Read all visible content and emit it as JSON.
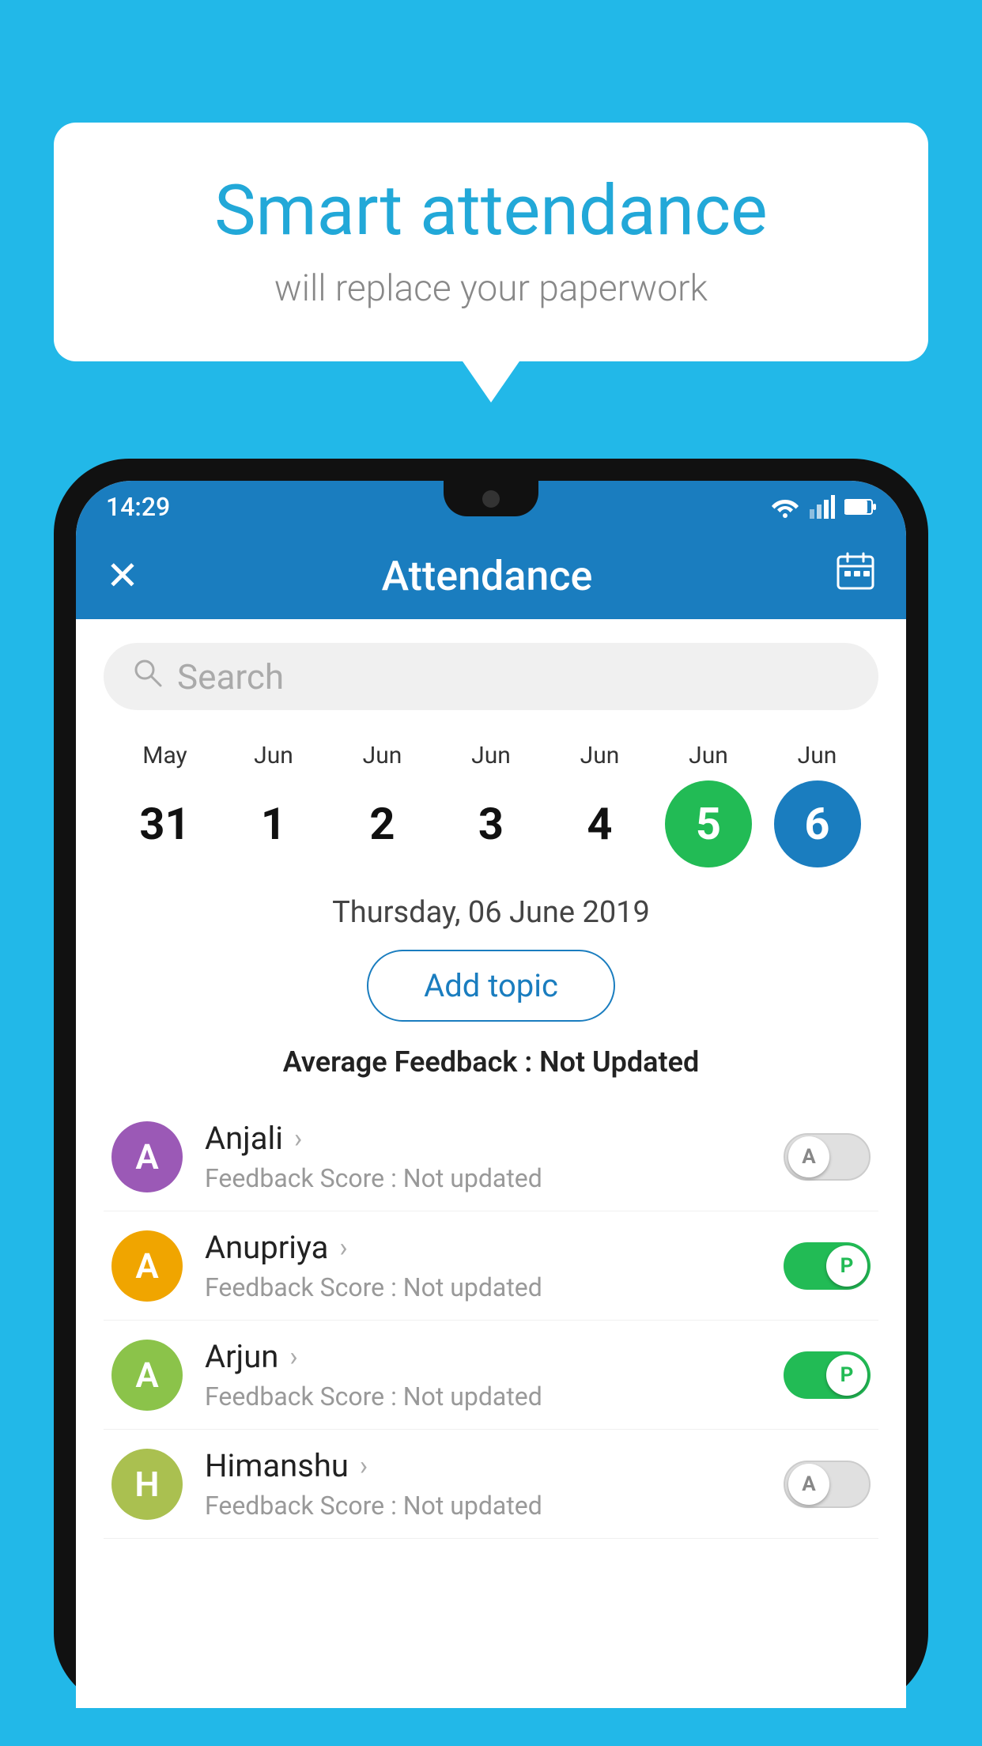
{
  "background_color": "#22b8e8",
  "speech_bubble": {
    "title": "Smart attendance",
    "subtitle": "will replace your paperwork"
  },
  "status_bar": {
    "time": "14:29"
  },
  "app_bar": {
    "title": "Attendance",
    "close_icon": "✕",
    "calendar_icon": "📅"
  },
  "search": {
    "placeholder": "Search"
  },
  "calendar": {
    "days": [
      {
        "month": "May",
        "date": "31",
        "style": "normal"
      },
      {
        "month": "Jun",
        "date": "1",
        "style": "normal"
      },
      {
        "month": "Jun",
        "date": "2",
        "style": "normal"
      },
      {
        "month": "Jun",
        "date": "3",
        "style": "normal"
      },
      {
        "month": "Jun",
        "date": "4",
        "style": "normal"
      },
      {
        "month": "Jun",
        "date": "5",
        "style": "today"
      },
      {
        "month": "Jun",
        "date": "6",
        "style": "selected"
      }
    ]
  },
  "selected_date": "Thursday, 06 June 2019",
  "add_topic_label": "Add topic",
  "avg_feedback": {
    "label": "Average Feedback : ",
    "value": "Not Updated"
  },
  "students": [
    {
      "name": "Anjali",
      "feedback": "Not updated",
      "avatar_color": "#9b59b6",
      "avatar_letter": "A",
      "toggle_state": "off",
      "toggle_label": "A"
    },
    {
      "name": "Anupriya",
      "feedback": "Not updated",
      "avatar_color": "#f0a500",
      "avatar_letter": "A",
      "toggle_state": "on",
      "toggle_label": "P"
    },
    {
      "name": "Arjun",
      "feedback": "Not updated",
      "avatar_color": "#8bc34a",
      "avatar_letter": "A",
      "toggle_state": "on",
      "toggle_label": "P"
    },
    {
      "name": "Himanshu",
      "feedback": "Not updated",
      "avatar_color": "#aac050",
      "avatar_letter": "H",
      "toggle_state": "off",
      "toggle_label": "A"
    }
  ],
  "feedback_score_label": "Feedback Score : "
}
